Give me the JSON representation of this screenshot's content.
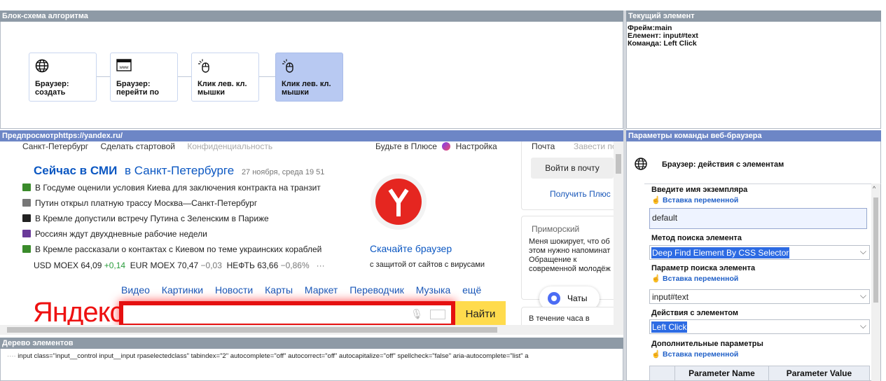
{
  "flowchart": {
    "title": "Блок-схема алгоритма",
    "nodes": [
      {
        "label": "Браузер: создать",
        "icon": "globe-icon"
      },
      {
        "label": "Браузер: перейти по",
        "icon": "www-window-icon"
      },
      {
        "label": "Клик лев. кл. мышки",
        "icon": "mouse-click-icon"
      },
      {
        "label": "Клик лев. кл. мышки",
        "icon": "mouse-click-icon"
      }
    ]
  },
  "current": {
    "title": "Текущий элемент",
    "frame": "Фрейм:main",
    "element": "Елемент: input#text",
    "command": "Команда: Left Click"
  },
  "preview": {
    "title": "Предпросмотрhttps://yandex.ru/",
    "top_links": [
      "Санкт-Петербург",
      "Сделать стартовой",
      "Конфиденциальность"
    ],
    "top_right": [
      "Будьте в Плюсе",
      "Настройка"
    ],
    "news_head": {
      "smi": "Сейчас в СМИ",
      "region": "в Санкт-Петербурге",
      "date": "27 ноября, среда 19 51"
    },
    "news": [
      {
        "text": "В Госдуме оценили условия Киева для заключения контракта на транзит",
        "color": "#3a8b2b"
      },
      {
        "text": "Путин открыл платную трассу Москва—Санкт-Петербург",
        "color": "#777777"
      },
      {
        "text": "В Кремле допустили встречу Путина с Зеленским в Париже",
        "color": "#222222"
      },
      {
        "text": "Россиян ждут двухдневные рабочие недели",
        "color": "#6a3a99"
      },
      {
        "text": "В Кремле рассказали о контактах с Киевом по теме украинских кораблей",
        "color": "#3a8b2b"
      }
    ],
    "rates": {
      "usd": "USD MOEX",
      "usd_val": "64,09",
      "usd_diff": "+0,14",
      "eur": "EUR MOEX",
      "eur_val": "70,47",
      "eur_diff": "−0,03",
      "oil": "НЕФТЬ",
      "oil_val": "63,66",
      "oil_diff": "−0,86%",
      "more": "···"
    },
    "services": [
      "Видео",
      "Картинки",
      "Новости",
      "Карты",
      "Маркет",
      "Переводчик",
      "Музыка",
      "ещё"
    ],
    "logo": "Яндекс",
    "find": "Найти",
    "download_title": "Скачайте браузер",
    "download_sub": "с защитой от сайтов с вирусами",
    "mail": {
      "title": "Почта",
      "register": "Завести по",
      "login": "Войти в почту",
      "plus": "Получить Плюс"
    },
    "region_card": {
      "title": "Приморский",
      "text1": "Меня шокирует, что об",
      "text2": "этом нужно напоминат",
      "text3": "Обращение к",
      "text4": "современной молодёж"
    },
    "chats": "Чаты",
    "hour": "В течение часа в"
  },
  "tree": {
    "title": "Дерево элементов",
    "line": "input class=\"input__control input__input rpaselectedclass\" tabindex=\"2\" autocomplete=\"off\" autocorrect=\"off\" autocapitalize=\"off\" spellcheck=\"false\" aria-autocomplete=\"list\" a"
  },
  "params": {
    "title": "Параметры команды веб-браузера",
    "command": "Браузер: действия с элементам",
    "instance_label": "Введите имя экземпляра",
    "insert_var": "Вставка переменной",
    "instance_value": "default",
    "method_label": "Метод поиска элемента",
    "method_value": "Deep Find Element By CSS Selector",
    "param_label": "Параметр поиска элемента",
    "param_value": "input#text",
    "action_label": "Действия с элементом",
    "action_value": "Left Click",
    "extra_label": "Дополнительные параметры",
    "grid_cols": [
      "Parameter Name",
      "Parameter Value"
    ]
  }
}
